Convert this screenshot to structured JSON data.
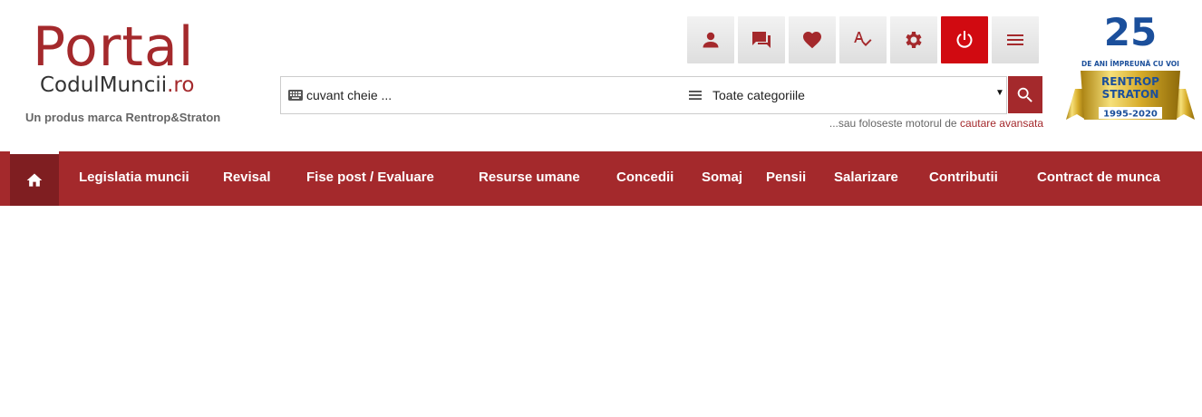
{
  "logo": {
    "portal": "Portal",
    "sub_main": "CodulMuncii",
    "sub_tld": ".ro",
    "tagline": "Un produs marca Rentrop&Straton"
  },
  "toolbar": {
    "icons": [
      "user-icon",
      "chat-icon",
      "heart-icon",
      "spellcheck-icon",
      "gear-icon",
      "power-icon",
      "menu-icon"
    ],
    "accent": "#a4292c",
    "power_color": "#d10a11"
  },
  "search": {
    "placeholder": "cuvant cheie ...",
    "category": "Toate categoriile",
    "adv_prefix": "...sau foloseste motorul de ",
    "adv_link": "cautare avansata"
  },
  "badge": {
    "number": "25",
    "line1": "DE ANI ÎMPREUNĂ CU VOI",
    "brand1": "RENTROP",
    "brand2": "STRATON",
    "years": "1995-2020"
  },
  "nav": {
    "items": [
      "Legislatia muncii",
      "Revisal",
      "Fise post / Evaluare",
      "Resurse umane",
      "Concedii",
      "Somaj",
      "Pensii",
      "Salarizare",
      "Contributii",
      "Contract de munca"
    ]
  }
}
